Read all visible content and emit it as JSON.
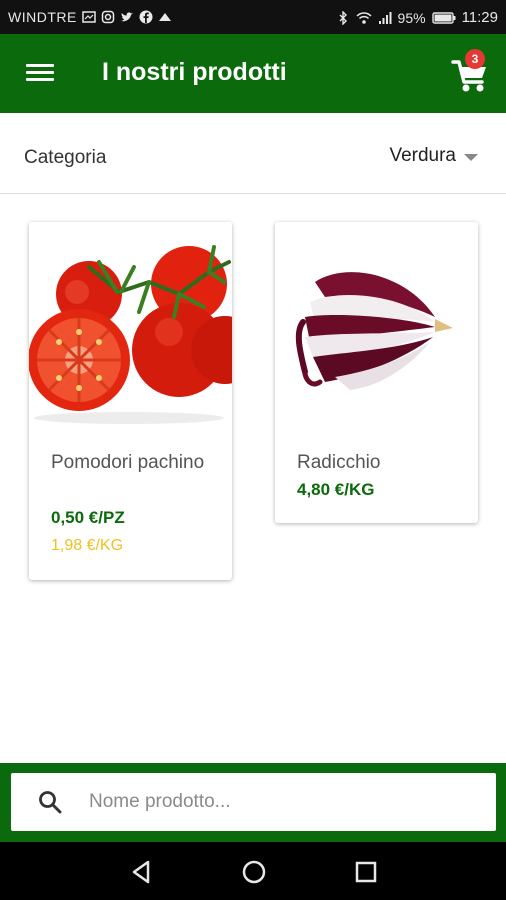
{
  "status_bar": {
    "carrier": "WINDTRE",
    "battery": "95%",
    "time": "11:29"
  },
  "app_bar": {
    "title": "I nostri prodotti",
    "cart_count": "3"
  },
  "filter": {
    "label": "Categoria",
    "selected": "Verdura"
  },
  "products": [
    {
      "name": "Pomodori pachino",
      "price": "0,50 €/PZ",
      "price_secondary": "1,98 €/KG"
    },
    {
      "name": "Radicchio",
      "price": "4,80 €/KG"
    }
  ],
  "search": {
    "placeholder": "Nome prodotto..."
  },
  "colors": {
    "primary": "#0b6a0b",
    "badge": "#e53935",
    "secondary_price": "#f0c020"
  }
}
